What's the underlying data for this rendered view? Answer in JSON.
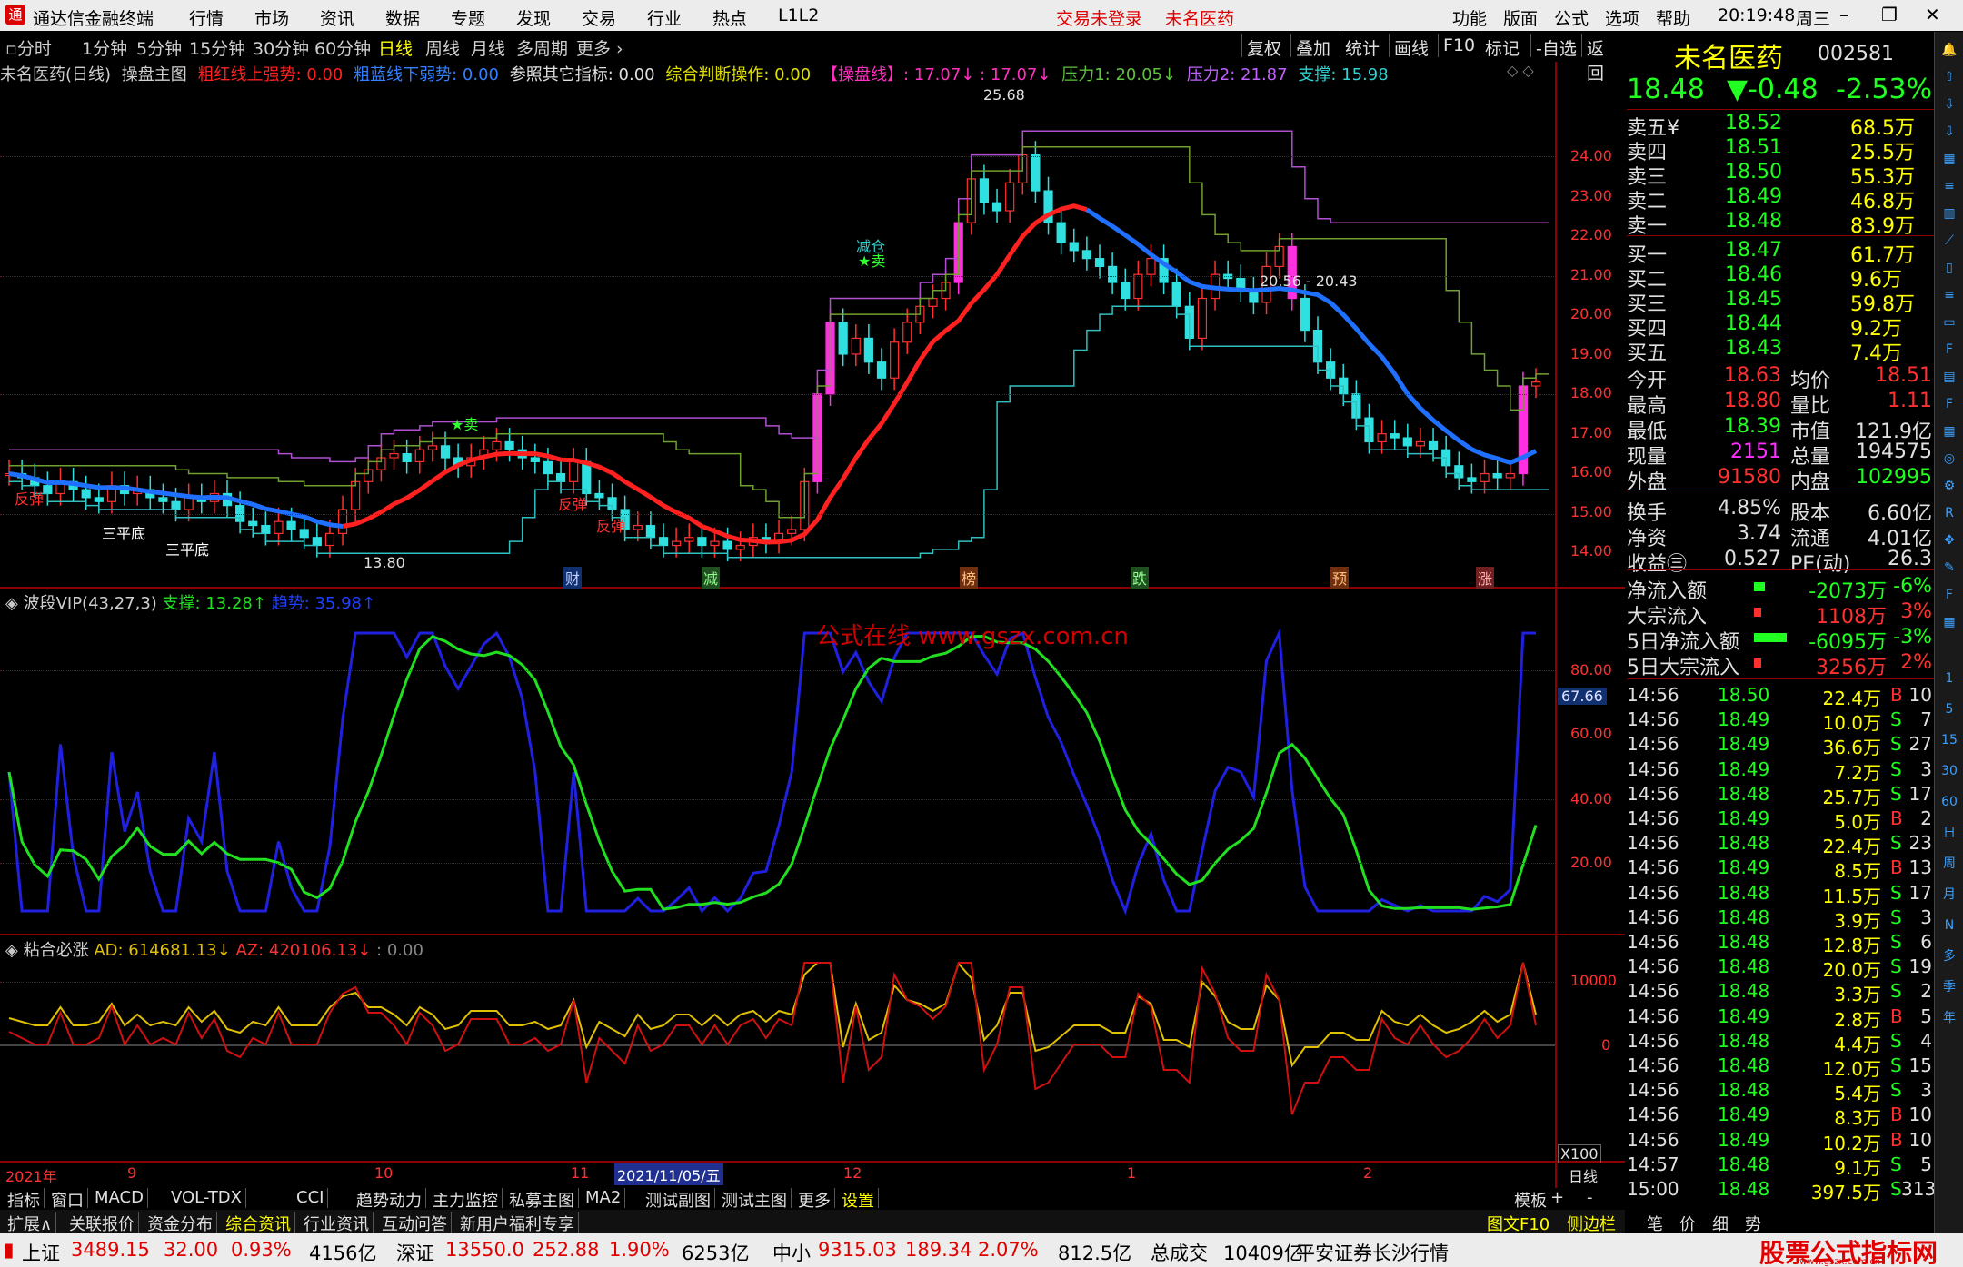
{
  "menubar": {
    "title": "通达信金融终端",
    "items": [
      "行情",
      "市场",
      "资讯",
      "数据",
      "专题",
      "发现",
      "交易",
      "行业",
      "热点",
      "L1L2"
    ],
    "login": "交易未登录",
    "stock": "未名医药",
    "right_items": [
      "功能",
      "版面",
      "公式",
      "选项",
      "帮助"
    ],
    "time": "20:19:48",
    "weekday": "周三",
    "win_min": "–",
    "win_max": "❐",
    "win_close": "✕"
  },
  "periodbar": {
    "items": [
      "分时",
      "1分钟",
      "5分钟",
      "15分钟",
      "30分钟",
      "60分钟",
      "日线",
      "周线",
      "月线",
      "多周期",
      "更多 ›"
    ],
    "selected": "日线",
    "tools": [
      "复权",
      "叠加",
      "统计",
      "画线",
      "F10",
      "标记",
      "-自选",
      "返回"
    ]
  },
  "main_indicator": {
    "name": "未名医药(日线)",
    "sub": "操盘主图",
    "t1": "粗红线上强势: 0.00",
    "t2": "粗蓝线下弱势: 0.00",
    "t3": "参照其它指标: 0.00",
    "t4": "综合判断操作: 0.00",
    "t5": "【操盘线】: 17.07↓ : 17.07↓",
    "t6": "压力1: 20.05↓",
    "t7": "压力2: 21.87",
    "t8": "支撑: 15.98"
  },
  "price_axis": [
    "24.00",
    "23.00",
    "22.00",
    "21.00",
    "20.00",
    "19.00",
    "18.00",
    "17.00",
    "16.00",
    "15.00",
    "14.00"
  ],
  "annotations": {
    "high": "25.68",
    "low": "13.80",
    "range": "20.56 - 20.43",
    "signals": [
      "反弹",
      "三平底",
      "三平底",
      "反弹",
      "反弹",
      "减仓",
      "★卖",
      "★卖"
    ],
    "events": [
      "财",
      "减",
      "榜",
      "跌",
      "预",
      "涨"
    ]
  },
  "osc": {
    "name": "波段VIP(43,27,3)",
    "support": "支撑: 13.28↑",
    "trend": "趋势: 35.98↑",
    "axis": [
      "80.00",
      "60.00",
      "40.00",
      "20.00"
    ],
    "cur": "67.66",
    "watermark": "公式在线  www.gszx.com.cn"
  },
  "ad": {
    "name": "粘合必涨",
    "ad": "AD: 614681.13↓",
    "az": "AZ: 420106.13↓",
    "z": ": 0.00",
    "axis": [
      "10000",
      "0"
    ],
    "mult": "X100"
  },
  "timebar": {
    "labels": [
      "2021年",
      "9",
      "10",
      "11",
      "2021/11/05/五",
      "12",
      "1",
      "2"
    ],
    "right": "日线"
  },
  "tabs": [
    "指标",
    "窗口",
    "MACD",
    "VOL-TDX",
    "CCI",
    "趋势动力",
    "主力监控",
    "私募主图",
    "MA2",
    "测试副图",
    "测试主图",
    "更多",
    "设置"
  ],
  "tabs_right": [
    "模板",
    "+",
    "-"
  ],
  "tabs2": [
    "扩展∧",
    "关联报价",
    "资金分布",
    "综合资讯",
    "行业资讯",
    "互动问答",
    "新用户福利专享"
  ],
  "tabs2_right": [
    "图文F10",
    "侧边栏《",
    "笔",
    "价",
    "细",
    "势"
  ],
  "quote": {
    "name": "未名医药",
    "code": "002581",
    "price": "18.48",
    "change": "▼-0.48",
    "pct": "-2.53%",
    "asks": [
      [
        "卖五¥",
        "18.52",
        "68.5万"
      ],
      [
        "卖四",
        "18.51",
        "25.5万"
      ],
      [
        "卖三",
        "18.50",
        "55.3万"
      ],
      [
        "卖二",
        "18.49",
        "46.8万"
      ],
      [
        "卖一",
        "18.48",
        "83.9万"
      ]
    ],
    "bids": [
      [
        "买一",
        "18.47",
        "61.7万"
      ],
      [
        "买二",
        "18.46",
        "9.6万"
      ],
      [
        "买三",
        "18.45",
        "59.8万"
      ],
      [
        "买四",
        "18.44",
        "9.2万"
      ],
      [
        "买五",
        "18.43",
        "7.4万"
      ]
    ],
    "stats": [
      [
        "今开",
        "18.63",
        "均价",
        "18.51"
      ],
      [
        "最高",
        "18.80",
        "量比",
        "1.11"
      ],
      [
        "最低",
        "18.39",
        "市值",
        "121.9亿"
      ],
      [
        "现量",
        "2151",
        "总量",
        "194575"
      ],
      [
        "外盘",
        "91580",
        "内盘",
        "102995"
      ],
      [
        "换手",
        "4.85%",
        "股本",
        "6.60亿"
      ],
      [
        "净资",
        "3.74",
        "流通",
        "4.01亿"
      ],
      [
        "收益㊂",
        "0.527",
        "PE(动)",
        "26.3"
      ]
    ],
    "flows": [
      [
        "净流入额",
        "-2073万",
        "-6%"
      ],
      [
        "大宗流入",
        "1108万",
        "3%"
      ],
      [
        "5日净流入额",
        "-6095万",
        "-3%"
      ],
      [
        "5日大宗流入",
        "3256万",
        "2%"
      ]
    ],
    "ticks": [
      [
        "14:56",
        "18.50",
        "22.4万",
        "B",
        "10"
      ],
      [
        "14:56",
        "18.49",
        "10.0万",
        "S",
        "7"
      ],
      [
        "14:56",
        "18.49",
        "36.6万",
        "S",
        "27"
      ],
      [
        "14:56",
        "18.49",
        "7.2万",
        "S",
        "3"
      ],
      [
        "14:56",
        "18.48",
        "25.7万",
        "S",
        "17"
      ],
      [
        "14:56",
        "18.49",
        "5.0万",
        "B",
        "2"
      ],
      [
        "14:56",
        "18.48",
        "22.4万",
        "S",
        "23"
      ],
      [
        "14:56",
        "18.49",
        "8.5万",
        "B",
        "13"
      ],
      [
        "14:56",
        "18.48",
        "11.5万",
        "S",
        "17"
      ],
      [
        "14:56",
        "18.48",
        "3.9万",
        "S",
        "3"
      ],
      [
        "14:56",
        "18.48",
        "12.8万",
        "S",
        "6"
      ],
      [
        "14:56",
        "18.48",
        "20.0万",
        "S",
        "19"
      ],
      [
        "14:56",
        "18.48",
        "3.3万",
        "S",
        "2"
      ],
      [
        "14:56",
        "18.49",
        "2.8万",
        "B",
        "5"
      ],
      [
        "14:56",
        "18.48",
        "4.4万",
        "S",
        "4"
      ],
      [
        "14:56",
        "18.48",
        "12.0万",
        "S",
        "15"
      ],
      [
        "14:56",
        "18.48",
        "5.4万",
        "S",
        "3"
      ],
      [
        "14:56",
        "18.49",
        "8.3万",
        "B",
        "10"
      ],
      [
        "14:56",
        "18.49",
        "10.2万",
        "B",
        "10"
      ],
      [
        "14:57",
        "18.48",
        "9.1万",
        "S",
        "5"
      ],
      [
        "15:00",
        "18.48",
        "397.5万",
        "S",
        "313"
      ]
    ]
  },
  "side_icons": [
    "1",
    "5",
    "15",
    "30",
    "60",
    "日",
    "周",
    "月",
    "N",
    "多",
    "季",
    "年"
  ],
  "status": {
    "sh": "上证",
    "sh_v": "3489.15",
    "sh_c": "32.00",
    "sh_p": "0.93%",
    "sh_a": "4156亿",
    "sz": "深证",
    "sz_v": "13550.0",
    "sz_c": "252.88",
    "sz_p": "1.90%",
    "sz_a": "6253亿",
    "zx": "中小",
    "zx_v": "9315.03",
    "zx_c": "189.34",
    "zx_p": "2.07%",
    "zx_a": "812.5亿",
    "total": "总成交",
    "total_v": "10409亿",
    "broker": "平安证券长沙行情",
    "brand": "股票公式指标网",
    "brand_url": "www.gszx.com.cn"
  },
  "chart_data": {
    "type": "candlestick",
    "ylim": [
      13.5,
      25.9
    ],
    "note_series": [
      "close",
      "ma_red_blue",
      "resist1",
      "resist2",
      "support"
    ],
    "close": [
      16.2,
      16.1,
      15.9,
      15.7,
      16.0,
      15.8,
      15.6,
      15.5,
      15.9,
      15.7,
      15.8,
      15.6,
      15.5,
      15.3,
      15.6,
      15.5,
      15.7,
      15.4,
      15.0,
      14.9,
      14.7,
      15.0,
      14.8,
      14.6,
      14.4,
      14.7,
      15.3,
      16.0,
      16.3,
      16.6,
      16.7,
      16.5,
      16.8,
      16.9,
      16.6,
      16.4,
      16.6,
      16.8,
      17.0,
      16.8,
      16.6,
      16.5,
      16.2,
      16.0,
      16.5,
      15.7,
      15.6,
      15.3,
      14.8,
      14.9,
      14.6,
      14.4,
      14.5,
      14.6,
      14.4,
      14.5,
      14.3,
      14.4,
      14.6,
      14.5,
      14.7,
      14.8,
      16.0,
      18.2,
      20.0,
      19.2,
      19.6,
      19.0,
      18.6,
      19.5,
      20.0,
      20.4,
      20.6,
      21.0,
      22.5,
      23.6,
      23.0,
      22.8,
      23.5,
      24.2,
      23.3,
      22.5,
      22.0,
      21.8,
      21.6,
      21.4,
      21.0,
      20.6,
      21.2,
      21.6,
      21.0,
      20.4,
      19.6,
      20.6,
      21.2,
      21.1,
      20.8,
      20.5,
      21.4,
      21.9,
      20.6,
      19.8,
      19.0,
      18.6,
      18.2,
      17.6,
      17.0,
      17.2,
      17.1,
      16.9,
      17.0,
      16.8,
      16.4,
      16.1,
      16.0,
      16.2,
      16.1,
      16.2,
      18.4,
      18.5
    ]
  }
}
